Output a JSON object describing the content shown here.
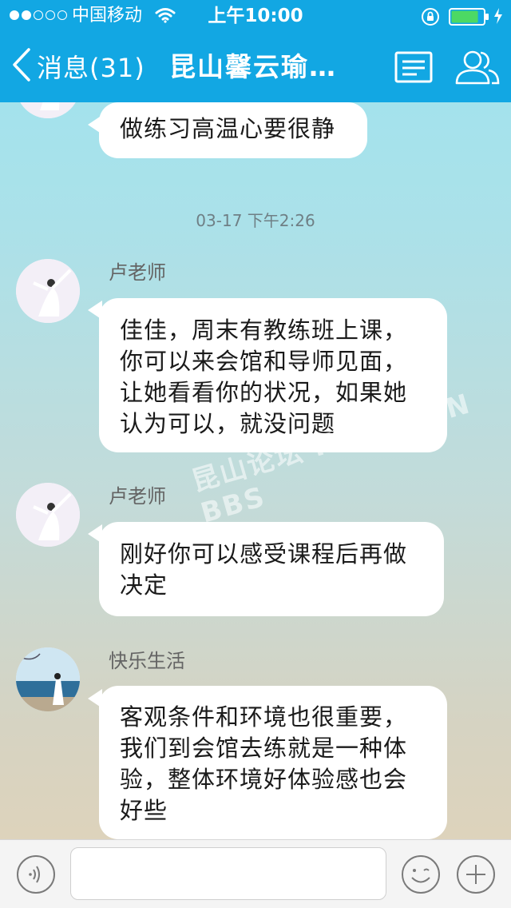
{
  "status_bar": {
    "carrier": "中国移动",
    "time": "上午10:00",
    "signal_bars_filled": 2,
    "signal_bars_total": 5,
    "battery_level": 0.85
  },
  "nav": {
    "back_label": "消息(31)",
    "title": "昆山馨云瑜…"
  },
  "messages": [
    {
      "text": "做练习高温心要很静"
    },
    {
      "sender": "卢老师",
      "text": "佳佳，周末有教练班上课，你可以来会馆和导师见面，让她看看你的状况，如果她认为可以，就没问题"
    },
    {
      "sender": "卢老师",
      "text": "刚好你可以感受课程后再做决定"
    },
    {
      "sender": "快乐生活",
      "text": "客观条件和环境也很重要，我们到会馆去练就是一种体验，整体环境好体验感也会好些"
    }
  ],
  "timestamp": "03-17 下午2:26",
  "watermark": "昆山论坛 KUNSHAN BBS",
  "input": {
    "value": "",
    "placeholder": ""
  },
  "colors": {
    "nav_bar": "#12a7e3",
    "bubble": "#ffffff",
    "background_top": "#9ee4ef",
    "background_bottom": "#e2d3b8"
  },
  "icons": {
    "wifi": "wifi-icon",
    "lock": "rotation-lock-icon",
    "battery": "battery-icon",
    "charging": "charging-icon",
    "back": "chevron-left-icon",
    "menu": "menu-icon",
    "contacts": "contacts-icon",
    "voice": "voice-icon",
    "emoji": "emoji-icon",
    "plus": "plus-icon"
  }
}
